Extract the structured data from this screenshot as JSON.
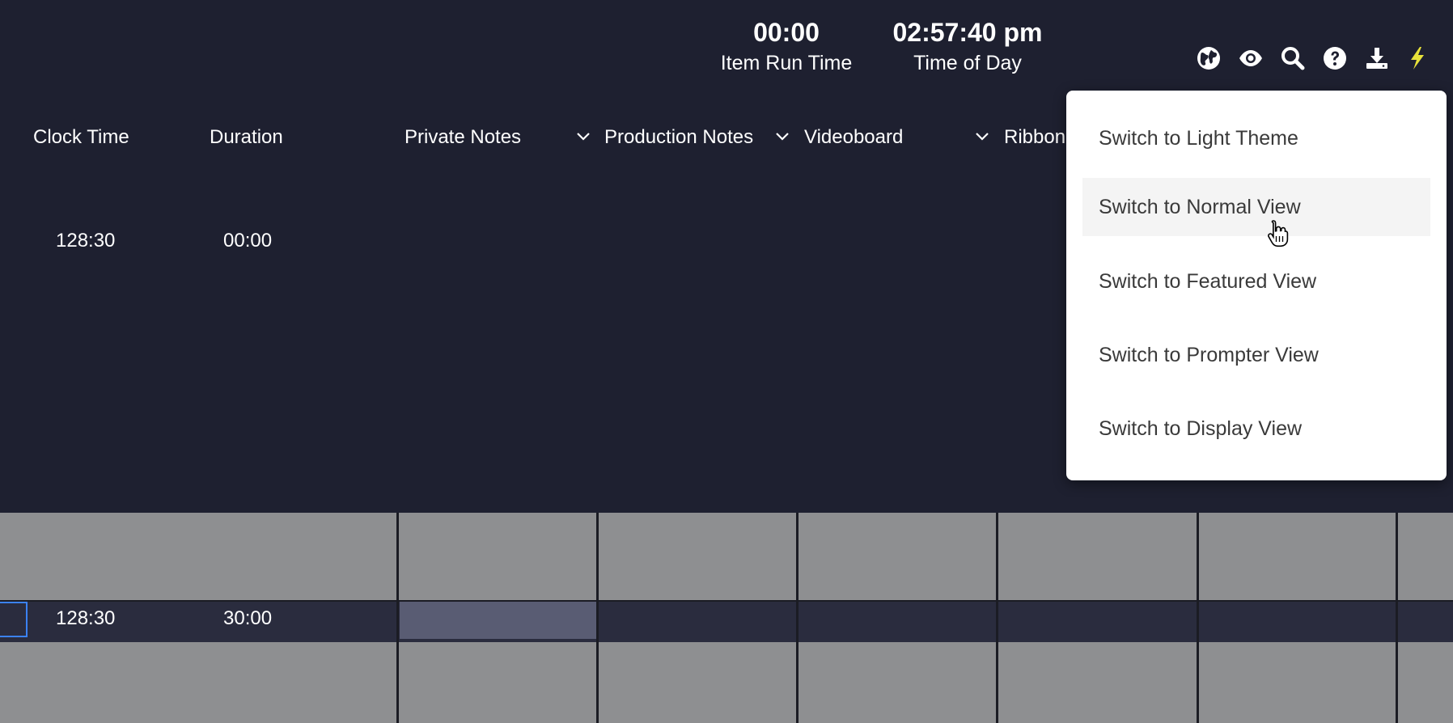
{
  "timers": {
    "run": {
      "value": "00:00",
      "label": "Item Run Time"
    },
    "tod": {
      "value": "02:57:40 pm",
      "label": "Time of Day"
    }
  },
  "toolbar": {
    "icons": [
      "globe-icon",
      "eye-icon",
      "search-icon",
      "help-icon",
      "download-icon",
      "lightning-icon"
    ],
    "lightning_color": "#e8e23a"
  },
  "columns": {
    "clock_time": "Clock Time",
    "duration": "Duration",
    "private_notes": "Private Notes",
    "production_notes": "Production Notes",
    "videoboard": "Videoboard",
    "ribbon": "Ribbon"
  },
  "header_row": {
    "clock": "128:30",
    "duration": "00:00"
  },
  "row": {
    "clock": "128:30",
    "duration": "30:00"
  },
  "menu": {
    "items": [
      "Switch to Light Theme",
      "Switch to Normal View",
      "Switch to Featured View",
      "Switch to Prompter View",
      "Switch to Display View"
    ],
    "hovered_index": 1
  },
  "colors": {
    "background": "#1e2030",
    "grid": "#8e8f91",
    "selection": "#595c73",
    "focus": "#3b82f6"
  }
}
